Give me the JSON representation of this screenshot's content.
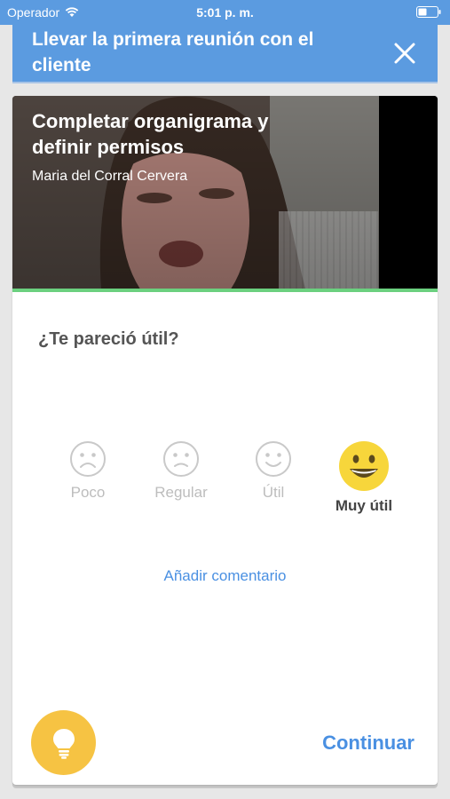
{
  "status_bar": {
    "carrier": "Operador",
    "time": "5:01 p. m."
  },
  "header": {
    "title": "Llevar la primera reunión con el cliente",
    "close_icon": "close-icon"
  },
  "video": {
    "title": "Completar organigrama y definir permisos",
    "author": "Maria del Corral Cervera",
    "progress_fraction": 1.0
  },
  "feedback": {
    "question": "¿Te pareció útil?",
    "options": [
      {
        "label": "Poco",
        "icon": "sad-face-icon",
        "selected": false
      },
      {
        "label": "Regular",
        "icon": "sad-face-icon",
        "selected": false
      },
      {
        "label": "Útil",
        "icon": "smile-face-icon",
        "selected": false
      },
      {
        "label": "Muy útil",
        "icon": "big-smile-face-icon",
        "selected": true
      }
    ],
    "add_comment": "Añadir comentario"
  },
  "footer": {
    "bulb_icon": "lightbulb-icon",
    "continue_label": "Continuar"
  },
  "colors": {
    "header": "#5b9be0",
    "accent": "#4a90e2",
    "progress": "#6bd07f",
    "bulb": "#f6c343",
    "selected_face": "#f7d63b"
  }
}
